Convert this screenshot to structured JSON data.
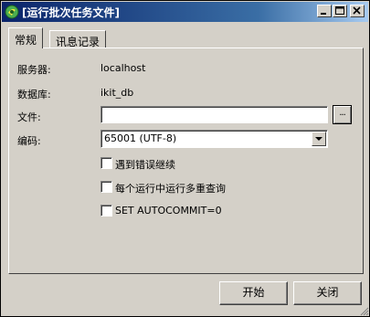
{
  "window": {
    "title": "[运行批次任务文件]",
    "controls": {
      "minimize_icon": "minimize-icon",
      "maximize_icon": "maximize-icon",
      "close_icon": "close-icon"
    }
  },
  "tabs": [
    {
      "label": "常规",
      "active": true
    },
    {
      "label": "讯息记录",
      "active": false
    }
  ],
  "general": {
    "server_label": "服务器:",
    "server_value": "localhost",
    "database_label": "数据库:",
    "database_value": "ikit_db",
    "file_label": "文件:",
    "file_value": "",
    "browse_label": "...",
    "encoding_label": "编码:",
    "encoding_value": "65001 (UTF-8)",
    "options": [
      {
        "label": "遇到错误继续",
        "checked": false
      },
      {
        "label": "每个运行中运行多重查询",
        "checked": false
      },
      {
        "label": "SET AUTOCOMMIT=0",
        "checked": false
      }
    ]
  },
  "footer": {
    "start_label": "开始",
    "close_label": "关闭"
  },
  "colors": {
    "face": "#d4d0c8",
    "title_gradient_start": "#0a246a",
    "title_gradient_end": "#a6caf0",
    "title_text": "#ffffff"
  }
}
